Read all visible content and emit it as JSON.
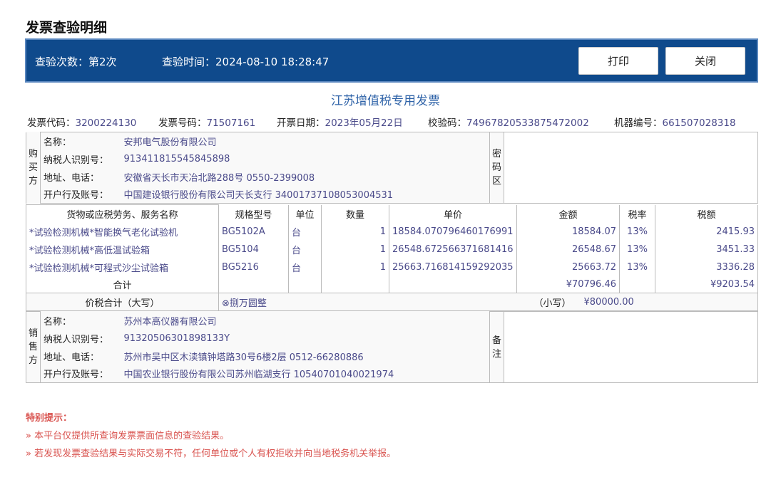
{
  "page_title": "发票查验明细",
  "bar": {
    "count_label": "查验次数：第2次",
    "time_label": "查验时间：2024-08-10 18:28:47",
    "print": "打印",
    "close": "关闭"
  },
  "invoice_title": "江苏增值税专用发票",
  "meta": {
    "code_label": "发票代码：",
    "code": "3200224130",
    "number_label": "发票号码：",
    "number": "71507161",
    "date_label": "开票日期：",
    "date": "2023年05月22日",
    "check_label": "校验码：",
    "check": "74967820533875472002",
    "machine_label": "机器编号：",
    "machine": "661507028318"
  },
  "buyer": {
    "side": "购买方",
    "name_label": "名称：",
    "name": "安邦电气股份有限公司",
    "tax_label": "纳税人识别号：",
    "tax_id": "913411815545845898",
    "addr_label": "地址、电话：",
    "addr": "安徽省天长市天冶北路288号 0550-2399008",
    "bank_label": "开户行及账号：",
    "bank": "中国建设银行股份有限公司天长支行 34001737108053004531",
    "cipher": "密码区"
  },
  "items": {
    "headers": [
      "货物或应税劳务、服务名称",
      "规格型号",
      "单位",
      "数量",
      "单价",
      "金额",
      "税率",
      "税额"
    ],
    "rows": [
      [
        "*试验检测机械*智能换气老化试验机",
        "BG5102A",
        "台",
        "1",
        "18584.070796460176991",
        "18584.07",
        "13%",
        "2415.93"
      ],
      [
        "*试验检测机械*高低温试验箱",
        "BG5104",
        "台",
        "1",
        "26548.672566371681416",
        "26548.67",
        "13%",
        "3451.33"
      ],
      [
        "*试验检测机械*可程式沙尘试验箱",
        "BG5216",
        "台",
        "1",
        "25663.716814159292035",
        "25663.72",
        "13%",
        "3336.28"
      ]
    ],
    "total_label": "合计",
    "total_amount": "¥70796.46",
    "total_tax": "¥9203.54"
  },
  "grand": {
    "label": "价税合计（大写）",
    "upper": "⊗捌万圆整",
    "small_label": "（小写）",
    "small": "¥80000.00"
  },
  "seller": {
    "side": "销售方",
    "name_label": "名称：",
    "name": "苏州本高仪器有限公司",
    "tax_label": "纳税人识别号：",
    "tax_id": "91320506301898133Y",
    "addr_label": "地址、电话：",
    "addr": "苏州市吴中区木渎镇钟塔路30号6楼2层 0512-66280886",
    "bank_label": "开户行及账号：",
    "bank": "中国农业银行股份有限公司苏州临湖支行 10540701040021974",
    "remark": "备注"
  },
  "notes": {
    "title": "特别提示：",
    "items": [
      "»  本平台仅提供所查询发票票面信息的查验结果。",
      "»  若发现发票查验结果与实际交易不符，任何单位或个人有权拒收并向当地税务机关举报。"
    ]
  }
}
